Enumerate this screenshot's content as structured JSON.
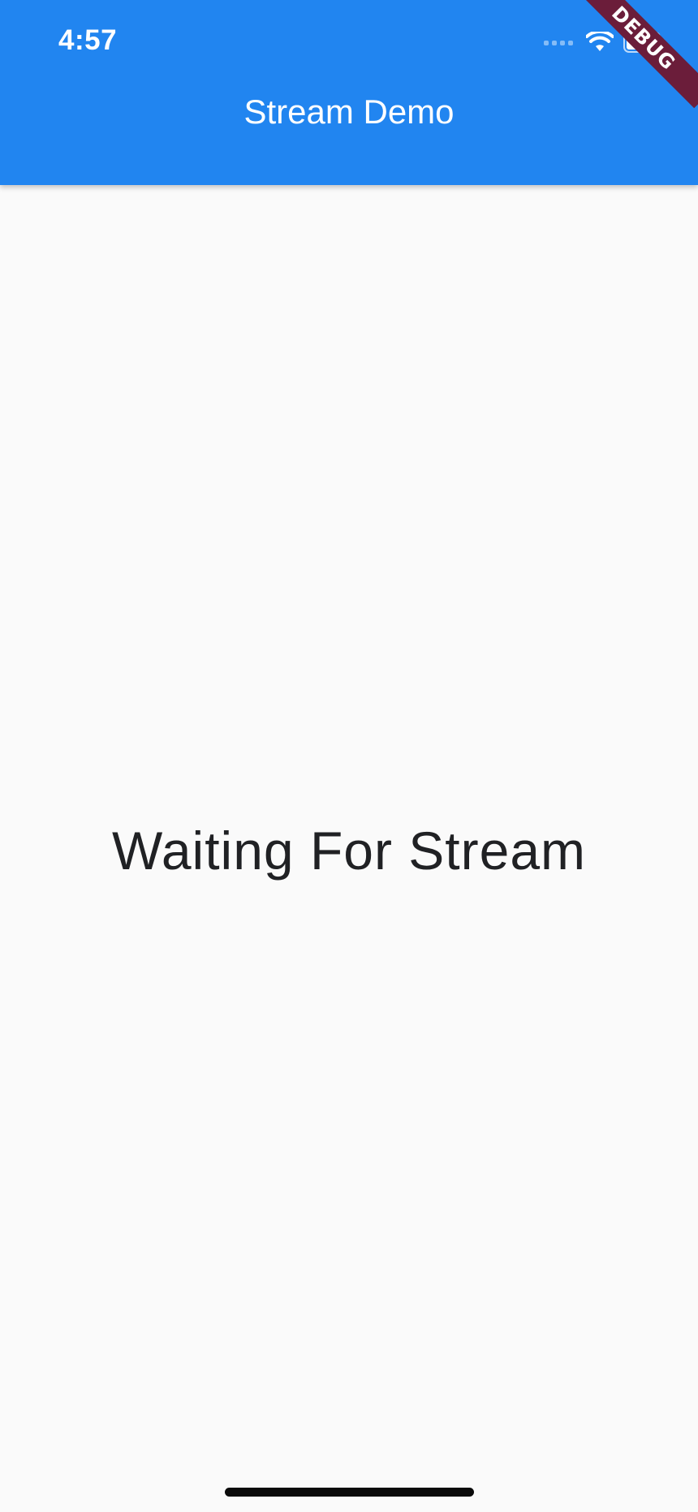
{
  "status_bar": {
    "time": "4:57",
    "icons": [
      "cellular-signal-icon",
      "wifi-icon",
      "battery-icon"
    ]
  },
  "app_bar": {
    "title": "Stream Demo",
    "color": "#2185f0"
  },
  "debug_banner": {
    "label": "DEBUG",
    "color": "#6b1d3a"
  },
  "body": {
    "message": "Waiting For Stream",
    "background": "#fafafa"
  }
}
